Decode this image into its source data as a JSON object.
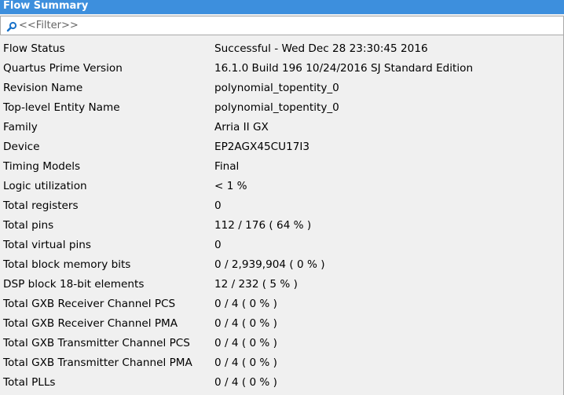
{
  "panel": {
    "title": "Flow Summary"
  },
  "filter": {
    "placeholder": "<<Filter>>",
    "icon": "search-icon"
  },
  "rows": [
    {
      "label": "Flow Status",
      "value": "Successful - Wed Dec 28 23:30:45 2016"
    },
    {
      "label": "Quartus Prime Version",
      "value": "16.1.0 Build 196 10/24/2016 SJ Standard Edition"
    },
    {
      "label": "Revision Name",
      "value": "polynomial_topentity_0"
    },
    {
      "label": "Top-level Entity Name",
      "value": "polynomial_topentity_0"
    },
    {
      "label": "Family",
      "value": "Arria II GX"
    },
    {
      "label": "Device",
      "value": "EP2AGX45CU17I3"
    },
    {
      "label": "Timing Models",
      "value": "Final"
    },
    {
      "label": "Logic utilization",
      "value": "< 1 %"
    },
    {
      "label": "Total registers",
      "value": "0"
    },
    {
      "label": "Total pins",
      "value": "112 / 176 ( 64 % )"
    },
    {
      "label": "Total virtual pins",
      "value": "0"
    },
    {
      "label": "Total block memory bits",
      "value": "0 / 2,939,904 ( 0 % )"
    },
    {
      "label": "DSP block 18-bit elements",
      "value": "12 / 232 ( 5 % )"
    },
    {
      "label": "Total GXB Receiver Channel PCS",
      "value": "0 / 4 ( 0 % )"
    },
    {
      "label": "Total GXB Receiver Channel PMA",
      "value": "0 / 4 ( 0 % )"
    },
    {
      "label": "Total GXB Transmitter Channel PCS",
      "value": "0 / 4 ( 0 % )"
    },
    {
      "label": "Total GXB Transmitter Channel PMA",
      "value": "0 / 4 ( 0 % )"
    },
    {
      "label": "Total PLLs",
      "value": "0 / 4 ( 0 % )"
    }
  ],
  "colors": {
    "title_bar": "#3d8fdd",
    "background": "#f0f0f0",
    "search_icon": "#1a73c9"
  }
}
